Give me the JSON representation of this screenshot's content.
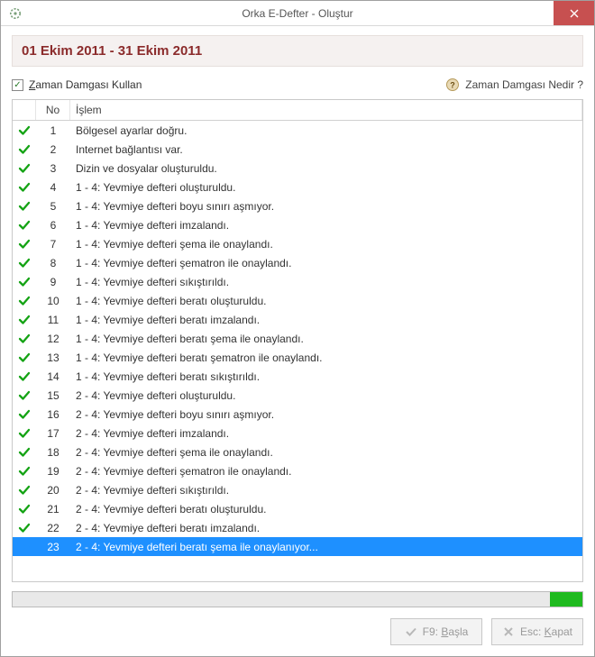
{
  "window": {
    "title": "Orka E-Defter - Oluştur",
    "close_label": "×"
  },
  "banner": {
    "date_range": "01 Ekim 2011 - 31 Ekim 2011"
  },
  "options": {
    "timestamp_checked": true,
    "timestamp_prefix": "Z",
    "timestamp_rest": "aman Damgası Kullan",
    "help_label": "Zaman Damgası Nedir ?"
  },
  "grid": {
    "headers": {
      "no": "No",
      "op": "İşlem"
    },
    "rows": [
      {
        "no": 1,
        "op": "Bölgesel ayarlar doğru.",
        "state": "ok"
      },
      {
        "no": 2,
        "op": "Internet bağlantısı var.",
        "state": "ok"
      },
      {
        "no": 3,
        "op": "Dizin ve dosyalar oluşturuldu.",
        "state": "ok"
      },
      {
        "no": 4,
        "op": "1 - 4: Yevmiye defteri oluşturuldu.",
        "state": "ok"
      },
      {
        "no": 5,
        "op": "1 - 4: Yevmiye defteri boyu sınırı aşmıyor.",
        "state": "ok"
      },
      {
        "no": 6,
        "op": "1 - 4: Yevmiye defteri imzalandı.",
        "state": "ok"
      },
      {
        "no": 7,
        "op": "1 - 4: Yevmiye defteri şema ile onaylandı.",
        "state": "ok"
      },
      {
        "no": 8,
        "op": "1 - 4: Yevmiye defteri şematron ile onaylandı.",
        "state": "ok"
      },
      {
        "no": 9,
        "op": "1 - 4: Yevmiye defteri sıkıştırıldı.",
        "state": "ok"
      },
      {
        "no": 10,
        "op": "1 - 4: Yevmiye defteri beratı oluşturuldu.",
        "state": "ok"
      },
      {
        "no": 11,
        "op": "1 - 4: Yevmiye defteri beratı imzalandı.",
        "state": "ok"
      },
      {
        "no": 12,
        "op": "1 - 4: Yevmiye defteri beratı şema ile onaylandı.",
        "state": "ok"
      },
      {
        "no": 13,
        "op": "1 - 4: Yevmiye defteri beratı şematron ile onaylandı.",
        "state": "ok"
      },
      {
        "no": 14,
        "op": "1 - 4: Yevmiye defteri beratı sıkıştırıldı.",
        "state": "ok"
      },
      {
        "no": 15,
        "op": "2 - 4: Yevmiye defteri oluşturuldu.",
        "state": "ok"
      },
      {
        "no": 16,
        "op": "2 - 4: Yevmiye defteri boyu sınırı aşmıyor.",
        "state": "ok"
      },
      {
        "no": 17,
        "op": "2 - 4: Yevmiye defteri imzalandı.",
        "state": "ok"
      },
      {
        "no": 18,
        "op": "2 - 4: Yevmiye defteri şema ile onaylandı.",
        "state": "ok"
      },
      {
        "no": 19,
        "op": "2 - 4: Yevmiye defteri şematron ile onaylandı.",
        "state": "ok"
      },
      {
        "no": 20,
        "op": "2 - 4: Yevmiye defteri sıkıştırıldı.",
        "state": "ok"
      },
      {
        "no": 21,
        "op": "2 - 4: Yevmiye defteri beratı oluşturuldu.",
        "state": "ok"
      },
      {
        "no": 22,
        "op": "2 - 4: Yevmiye defteri beratı imzalandı.",
        "state": "ok"
      },
      {
        "no": 23,
        "op": "2 - 4: Yevmiye defteri beratı şema ile onaylanıyor...",
        "state": "active"
      }
    ]
  },
  "buttons": {
    "start_prefix": "F9: ",
    "start_u": "B",
    "start_rest": "aşla",
    "close_prefix": "Esc: ",
    "close_u": "K",
    "close_rest": "apat"
  },
  "progress": {
    "percent_right_segment": 6
  }
}
